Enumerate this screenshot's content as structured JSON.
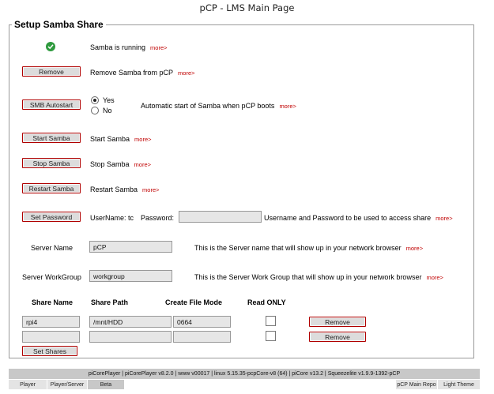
{
  "window": {
    "title": "pCP - LMS Main Page"
  },
  "section": {
    "legend": "Setup Samba Share"
  },
  "more_label": "more>",
  "status": {
    "text": "Samba is running"
  },
  "remove": {
    "button": "Remove",
    "text": "Remove Samba from pCP"
  },
  "autostart": {
    "button": "SMB Autostart",
    "yes": "Yes",
    "no": "No",
    "selected": "Yes",
    "text": "Automatic start of Samba when pCP boots"
  },
  "start": {
    "button": "Start Samba",
    "text": "Start Samba"
  },
  "stop": {
    "button": "Stop Samba",
    "text": "Stop Samba"
  },
  "restart": {
    "button": "Restart Samba",
    "text": "Restart Samba"
  },
  "password": {
    "button": "Set Password",
    "username_label": "UserName: tc",
    "password_label": "Password:",
    "password_value": "",
    "text": "Username and Password to be used to access share"
  },
  "server_name": {
    "label": "Server Name",
    "value": "pCP",
    "text": "This is the Server name that will show up in your network browser"
  },
  "workgroup": {
    "label": "Server WorkGroup",
    "value": "workgroup",
    "text": "This is the Server Work Group that will show up in your network browser"
  },
  "shares": {
    "headers": [
      "Share Name",
      "Share Path",
      "Create File Mode",
      "Read ONLY"
    ],
    "rows": [
      {
        "name": "rpi4",
        "path": "/mnt/HDD",
        "mode": "0664",
        "readonly": false,
        "button": "Remove"
      },
      {
        "name": "",
        "path": "",
        "mode": "",
        "readonly": false,
        "button": "Remove"
      }
    ],
    "set_button": "Set Shares"
  },
  "footer": {
    "text": "piCorePlayer | piCorePlayer v8.2.0 | www v00017 | linux 5.15.35-pcpCore-v8 (64) | piCore v13.2 | Squeezelite v1.9.9-1392-pCP"
  },
  "tabs": {
    "player": "Player",
    "player_server": "Player/Server",
    "beta": "Beta",
    "main_repo": "pCP Main Repo",
    "light_theme": "Light Theme"
  }
}
